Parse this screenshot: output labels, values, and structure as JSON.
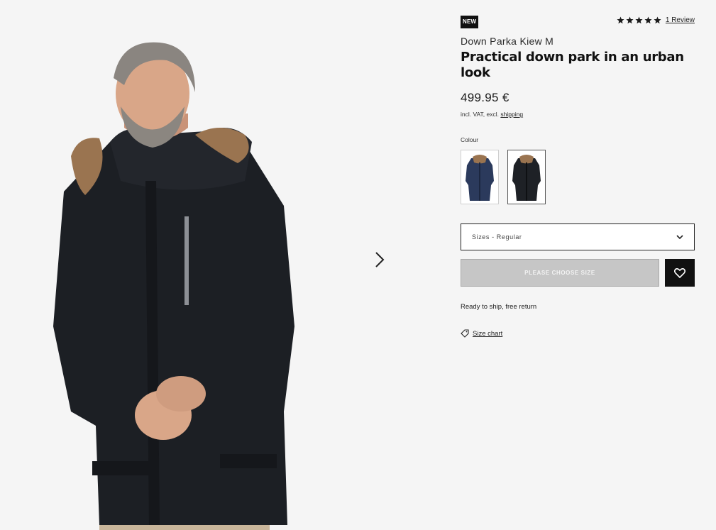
{
  "badge": {
    "label": "NEW"
  },
  "rating": {
    "stars": 5,
    "review_text": "1 Review"
  },
  "product": {
    "name": "Down Parka Kiew M",
    "title": "Practical down park in an urban look",
    "price": "499.95 €",
    "vat_prefix": "incl. VAT, excl.",
    "vat_link": "shipping"
  },
  "colour": {
    "label": "Colour",
    "options": [
      {
        "name": "navy-parka",
        "color": "#2b3a5c"
      },
      {
        "name": "black-parka",
        "color": "#1e2126"
      }
    ]
  },
  "sizes": {
    "selected": "Sizes - Regular"
  },
  "actions": {
    "choose_size": "PLEASE CHOOSE SIZE"
  },
  "shipping_note": "Ready to ship, free return",
  "size_chart": {
    "label": "Size chart"
  },
  "theme": {
    "jacket": "#1c1f24",
    "fur": "#9a7450",
    "skin": "#d9a688",
    "hair": "#8a8580"
  }
}
